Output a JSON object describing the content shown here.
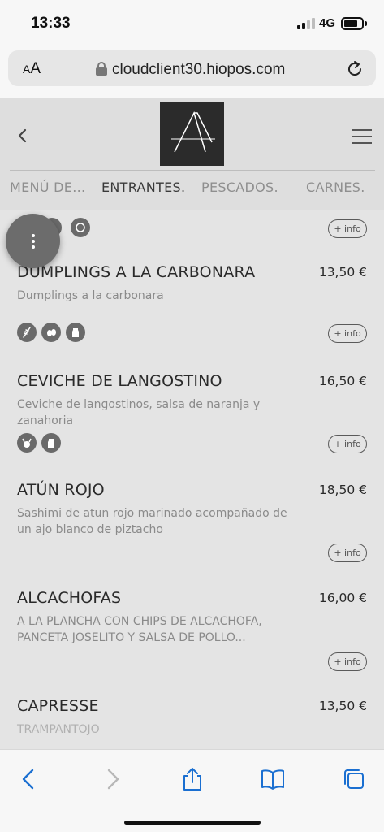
{
  "status_bar": {
    "time": "13:33",
    "network": "4G"
  },
  "browser": {
    "text_size_label_small": "A",
    "text_size_label_big": "A",
    "url": "cloudclient30.hiopos.com"
  },
  "tabs": [
    {
      "label": "MENÚ DE..."
    },
    {
      "label": "ENTRANTES."
    },
    {
      "label": "PESCADOS."
    },
    {
      "label": "CARNES."
    }
  ],
  "active_tab": "ENTRANTES.",
  "info_label": "+ info",
  "items": [
    {
      "name": "DUMPLINGS A LA CARBONARA",
      "price": "13,50 €",
      "desc": "Dumplings a la carbonara",
      "allergens": [
        "gluten-icon",
        "eggs-icon",
        "milk-icon"
      ]
    },
    {
      "name": "CEVICHE DE LANGOSTINO",
      "price": "16,50 €",
      "desc": "Ceviche de langostinos, salsa de naranja y zanahoria",
      "allergens": [
        "crustaceans-icon",
        "milk-icon"
      ]
    },
    {
      "name": "ATÚN ROJO",
      "price": "18,50 €",
      "desc": "Sashimi de atun rojo marinado acompañado de un ajo blanco de piztacho",
      "allergens": []
    },
    {
      "name": "ALCACHOFAS",
      "price": "16,00 €",
      "desc": "A LA PLANCHA CON CHIPS DE ALCACHOFA, PANCETA JOSELITO Y SALSA DE POLLO...",
      "allergens": []
    },
    {
      "name": "CAPRESSE",
      "price": "13,50 €",
      "desc": "TRAMPANTOJO",
      "allergens": []
    }
  ],
  "colors": {
    "overlay_bg": "#e4e4e4",
    "accent_blue": "#1a6fd1",
    "logo_bg": "#2b2b2b"
  }
}
